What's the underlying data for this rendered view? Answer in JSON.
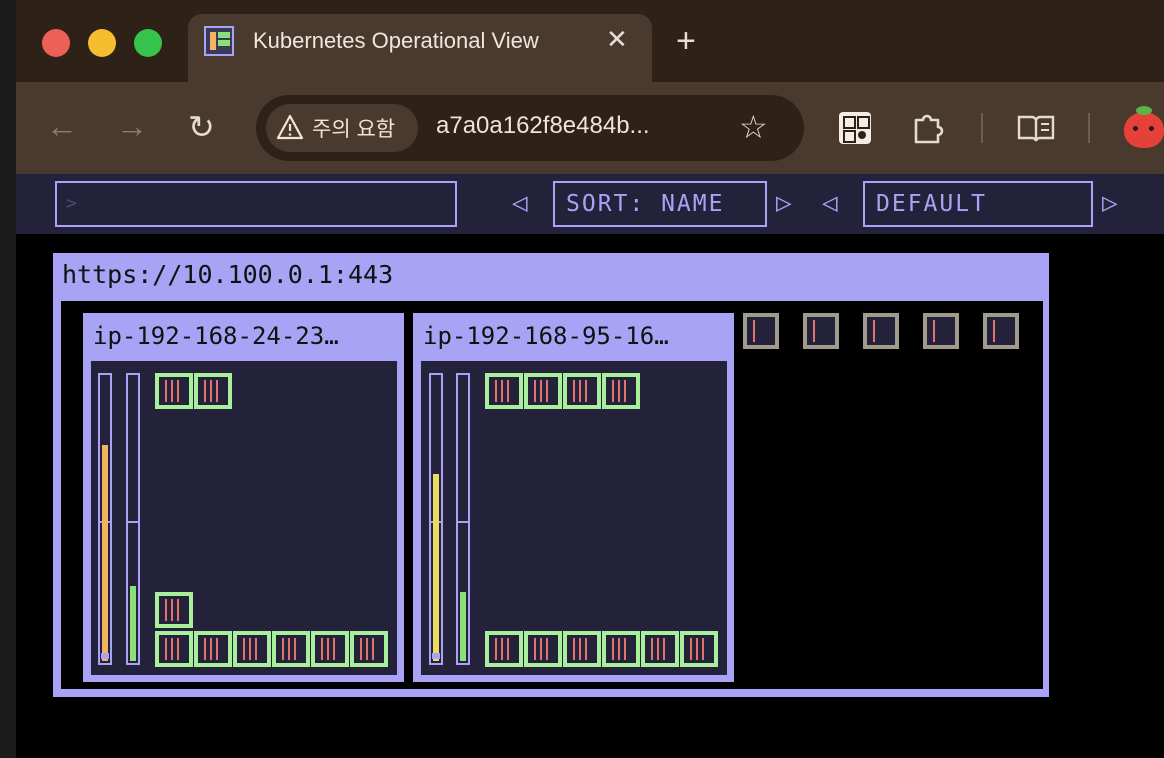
{
  "browser": {
    "tab_title": "Kubernetes Operational View",
    "tab_close": "✕",
    "new_tab": "+",
    "security_chip": "주의 요함",
    "url": "a7a0a162f8e484b..."
  },
  "app": {
    "filter_prompt": ">",
    "sort_label": "SORT: NAME",
    "theme_label": "DEFAULT",
    "left_arrow": "◁",
    "right_arrow": "▷"
  },
  "cluster": {
    "api_server": "https://10.100.0.1:443",
    "nodes": [
      {
        "name": "ip-192-168-24-23…",
        "cpu_usage": 0.75,
        "memory_usage": 0.26,
        "top_pods": 2,
        "bottom_pods": 7
      },
      {
        "name": "ip-192-168-95-16…",
        "cpu_usage": 0.65,
        "memory_usage": 0.24,
        "top_pods": 4,
        "bottom_pods": 6
      }
    ],
    "unassigned_pods": 5
  },
  "colors": {
    "accent": "#a9a3f5",
    "panel": "#23223a",
    "pod_border": "#a8ef9b",
    "cpu_bar": "#f2b45e",
    "cpu_bar_alt": "#eadb61",
    "memory_bar": "#8ce07a",
    "unassigned_border": "#a09b8a"
  }
}
